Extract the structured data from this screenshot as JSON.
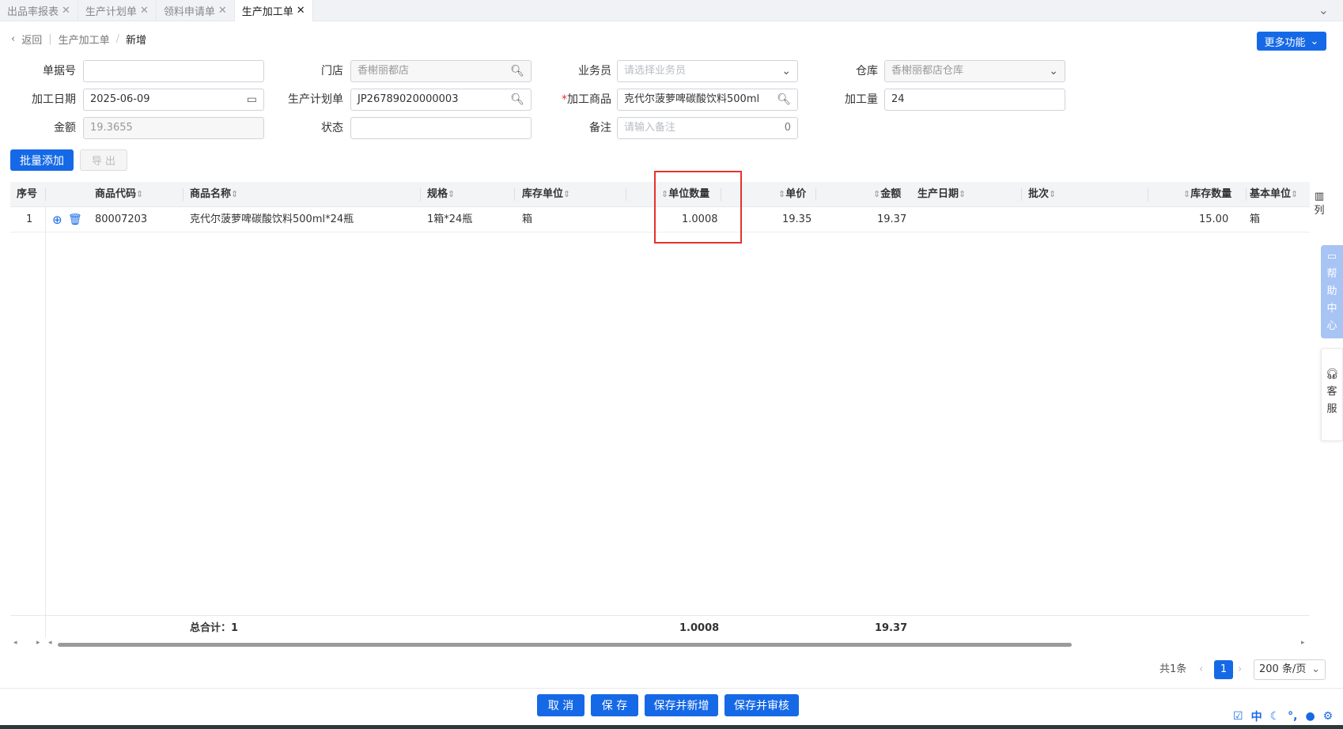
{
  "tabs": [
    {
      "label": "出品率报表",
      "active": false
    },
    {
      "label": "生产计划单",
      "active": false
    },
    {
      "label": "领料申请单",
      "active": false
    },
    {
      "label": "生产加工单",
      "active": true
    }
  ],
  "breadcrumb": {
    "back": "返回",
    "parent": "生产加工单",
    "current": "新增"
  },
  "more_button": "更多功能",
  "form": {
    "doc_no": {
      "label": "单据号",
      "value": ""
    },
    "store": {
      "label": "门店",
      "value": "香榭丽都店"
    },
    "salesman": {
      "label": "业务员",
      "placeholder": "请选择业务员"
    },
    "warehouse": {
      "label": "仓库",
      "value": "香榭丽都店仓库"
    },
    "process_date": {
      "label": "加工日期",
      "value": "2025-06-09"
    },
    "plan": {
      "label": "生产计划单",
      "value": "JP26789020000003"
    },
    "product": {
      "label": "加工商品",
      "value": "克代尔菠萝啤碳酸饮料500ml"
    },
    "quantity": {
      "label": "加工量",
      "value": "24"
    },
    "amount": {
      "label": "金额",
      "value": "19.3655"
    },
    "status": {
      "label": "状态",
      "value": ""
    },
    "remark": {
      "label": "备注",
      "placeholder": "请输入备注",
      "count": "0"
    }
  },
  "buttons": {
    "batch_add": "批量添加",
    "export": "导 出"
  },
  "table": {
    "headers": [
      "序号",
      "商品代码",
      "商品名称",
      "规格",
      "库存单位",
      "单位数量",
      "单价",
      "金额",
      "生产日期",
      "批次",
      "库存数量",
      "基本单位"
    ],
    "rows": [
      {
        "index": "1",
        "code": "80007203",
        "name": "克代尔菠萝啤碳酸饮料500ml*24瓶",
        "spec": "1箱*24瓶",
        "stock_unit": "箱",
        "unit_qty": "1.0008",
        "price": "19.35",
        "amount": "19.37",
        "prod_date": "",
        "batch": "",
        "stock_qty": "15.00",
        "base_unit": "箱"
      }
    ],
    "footer": {
      "total_label": "总合计：1",
      "unit_qty": "1.0008",
      "amount": "19.37"
    },
    "column_button": "列"
  },
  "pagination": {
    "total": "共1条",
    "page": "1",
    "page_size": "200 条/页"
  },
  "actions": {
    "cancel": "取 消",
    "save": "保 存",
    "save_new": "保存并新增",
    "save_audit": "保存并审核"
  },
  "side": {
    "help": "帮助中心",
    "service": "客服"
  },
  "tray": {
    "ime": "中"
  },
  "colors": {
    "primary": "#1669e6",
    "highlight": "#e5322d"
  }
}
